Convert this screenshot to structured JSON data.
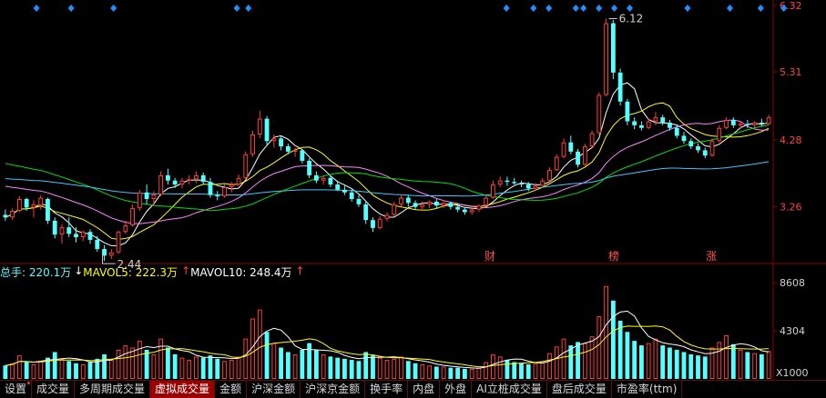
{
  "tabs": [
    {
      "label": "设置",
      "dot": true
    },
    {
      "label": "成交量"
    },
    {
      "label": "多周期成交量"
    },
    {
      "label": "虚拟成交量",
      "active": true
    },
    {
      "label": "金额"
    },
    {
      "label": "沪深金额"
    },
    {
      "label": "沪深京金额"
    },
    {
      "label": "换手率"
    },
    {
      "label": "内盘"
    },
    {
      "label": "外盘"
    },
    {
      "label": "AI立桩成交量"
    },
    {
      "label": "盘后成交量"
    },
    {
      "label": "市盈率(ttm)"
    }
  ],
  "volume_legend": {
    "total_label": "总手: 220.1万",
    "mavol5_arrow": "↓",
    "mavol5_label": "MAVOL5: 222.3万",
    "mavol10_arrow": "↑",
    "mavol10_label": "MAVOL10: 248.4万",
    "mavol10_tail_arrow": "↑"
  },
  "colors": {
    "up": "#ff3c3c",
    "down": "#54ffff",
    "ma5": "#ffffff",
    "ma10": "#ffff00",
    "ma20": "#ff80ff",
    "ma30": "#00e000",
    "ma60": "#3cc8ff",
    "vol_ma5": "#ffffff",
    "vol_ma10": "#ffff00",
    "axis": "#8b0000",
    "axis_label": "#ff4040",
    "diamond": "#1e90ff"
  },
  "chart_data": [
    {
      "type": "candlestick",
      "title": "",
      "y_ticks": [
        "6.32",
        "5.31",
        "4.28",
        "3.26"
      ],
      "ylim": [
        2.4,
        6.32
      ],
      "annotations": {
        "high": {
          "label": "6.12",
          "value": 6.12
        },
        "low": {
          "label": "2.44",
          "value": 2.44
        }
      },
      "event_markers": [
        "财",
        "榜",
        "涨"
      ],
      "ohlc": [
        [
          3.14,
          3.22,
          3.05,
          3.1
        ],
        [
          3.1,
          3.24,
          3.06,
          3.2
        ],
        [
          3.2,
          3.42,
          3.18,
          3.38
        ],
        [
          3.38,
          3.4,
          3.2,
          3.25
        ],
        [
          3.25,
          3.36,
          3.1,
          3.3
        ],
        [
          3.28,
          3.44,
          3.22,
          3.4
        ],
        [
          3.38,
          3.4,
          3.0,
          3.05
        ],
        [
          3.05,
          3.1,
          2.78,
          2.84
        ],
        [
          2.84,
          3.0,
          2.7,
          2.95
        ],
        [
          2.95,
          3.1,
          2.8,
          2.85
        ],
        [
          2.85,
          2.95,
          2.72,
          2.8
        ],
        [
          2.8,
          2.9,
          2.74,
          2.88
        ],
        [
          2.88,
          2.92,
          2.7,
          2.76
        ],
        [
          2.76,
          2.82,
          2.58,
          2.62
        ],
        [
          2.62,
          2.68,
          2.44,
          2.52
        ],
        [
          2.52,
          2.62,
          2.47,
          2.57
        ],
        [
          2.57,
          2.9,
          2.55,
          2.88
        ],
        [
          2.88,
          3.05,
          2.85,
          2.98
        ],
        [
          2.98,
          3.3,
          2.96,
          3.24
        ],
        [
          3.24,
          3.52,
          3.2,
          3.48
        ],
        [
          3.48,
          3.6,
          3.3,
          3.38
        ],
        [
          3.38,
          3.5,
          3.28,
          3.45
        ],
        [
          3.45,
          3.8,
          3.42,
          3.74
        ],
        [
          3.74,
          3.84,
          3.6,
          3.66
        ],
        [
          3.66,
          3.7,
          3.55,
          3.6
        ],
        [
          3.6,
          3.7,
          3.54,
          3.66
        ],
        [
          3.66,
          3.74,
          3.6,
          3.68
        ],
        [
          3.68,
          3.8,
          3.62,
          3.74
        ],
        [
          3.74,
          3.78,
          3.6,
          3.64
        ],
        [
          3.64,
          3.7,
          3.4,
          3.44
        ],
        [
          3.44,
          3.5,
          3.36,
          3.42
        ],
        [
          3.42,
          3.6,
          3.4,
          3.56
        ],
        [
          3.56,
          3.64,
          3.48,
          3.6
        ],
        [
          3.6,
          3.75,
          3.58,
          3.7
        ],
        [
          3.7,
          4.1,
          3.68,
          4.06
        ],
        [
          4.06,
          4.42,
          4.02,
          4.36
        ],
        [
          4.36,
          4.72,
          4.3,
          4.6
        ],
        [
          4.6,
          4.64,
          4.2,
          4.26
        ],
        [
          4.26,
          4.36,
          4.16,
          4.3
        ],
        [
          4.3,
          4.34,
          4.12,
          4.18
        ],
        [
          4.18,
          4.22,
          4.06,
          4.1
        ],
        [
          4.1,
          4.16,
          4.02,
          4.12
        ],
        [
          4.12,
          4.14,
          3.92,
          3.96
        ],
        [
          3.96,
          4.0,
          3.7,
          3.74
        ],
        [
          3.74,
          3.8,
          3.62,
          3.66
        ],
        [
          3.66,
          3.74,
          3.6,
          3.7
        ],
        [
          3.7,
          3.74,
          3.56,
          3.6
        ],
        [
          3.6,
          3.66,
          3.5,
          3.52
        ],
        [
          3.52,
          3.58,
          3.44,
          3.48
        ],
        [
          3.48,
          3.52,
          3.34,
          3.38
        ],
        [
          3.38,
          3.44,
          3.26,
          3.3
        ],
        [
          3.3,
          3.34,
          3.0,
          3.06
        ],
        [
          3.06,
          3.1,
          2.88,
          2.94
        ],
        [
          2.94,
          3.12,
          2.92,
          3.08
        ],
        [
          3.08,
          3.18,
          3.04,
          3.14
        ],
        [
          3.14,
          3.34,
          3.12,
          3.3
        ],
        [
          3.3,
          3.44,
          3.26,
          3.4
        ],
        [
          3.4,
          3.44,
          3.26,
          3.32
        ],
        [
          3.32,
          3.36,
          3.22,
          3.26
        ],
        [
          3.26,
          3.34,
          3.2,
          3.3
        ],
        [
          3.3,
          3.36,
          3.24,
          3.34
        ],
        [
          3.34,
          3.38,
          3.24,
          3.28
        ],
        [
          3.28,
          3.36,
          3.24,
          3.32
        ],
        [
          3.32,
          3.34,
          3.22,
          3.26
        ],
        [
          3.26,
          3.3,
          3.18,
          3.22
        ],
        [
          3.22,
          3.26,
          3.14,
          3.18
        ],
        [
          3.18,
          3.24,
          3.14,
          3.22
        ],
        [
          3.22,
          3.3,
          3.18,
          3.28
        ],
        [
          3.28,
          3.44,
          3.26,
          3.4
        ],
        [
          3.4,
          3.66,
          3.38,
          3.6
        ],
        [
          3.6,
          3.72,
          3.56,
          3.66
        ],
        [
          3.66,
          3.72,
          3.58,
          3.64
        ],
        [
          3.64,
          3.7,
          3.6,
          3.62
        ],
        [
          3.62,
          3.66,
          3.56,
          3.6
        ],
        [
          3.6,
          3.64,
          3.5,
          3.54
        ],
        [
          3.54,
          3.62,
          3.5,
          3.58
        ],
        [
          3.58,
          3.7,
          3.56,
          3.66
        ],
        [
          3.66,
          3.86,
          3.64,
          3.82
        ],
        [
          3.82,
          4.06,
          3.8,
          4.02
        ],
        [
          4.02,
          4.3,
          4.0,
          4.24
        ],
        [
          4.24,
          4.34,
          4.06,
          4.1
        ],
        [
          4.1,
          4.14,
          3.86,
          3.9
        ],
        [
          3.9,
          4.22,
          3.88,
          4.18
        ],
        [
          4.18,
          4.42,
          4.16,
          4.38
        ],
        [
          4.38,
          5.0,
          4.36,
          4.96
        ],
        [
          4.96,
          6.12,
          4.94,
          6.05
        ],
        [
          6.05,
          6.1,
          5.2,
          5.3
        ],
        [
          5.3,
          5.36,
          4.8,
          4.86
        ],
        [
          4.86,
          4.9,
          4.5,
          4.56
        ],
        [
          4.56,
          4.62,
          4.44,
          4.5
        ],
        [
          4.5,
          4.56,
          4.42,
          4.46
        ],
        [
          4.46,
          4.6,
          4.44,
          4.56
        ],
        [
          4.56,
          4.7,
          4.5,
          4.62
        ],
        [
          4.62,
          4.66,
          4.5,
          4.54
        ],
        [
          4.54,
          4.58,
          4.42,
          4.46
        ],
        [
          4.46,
          4.5,
          4.3,
          4.34
        ],
        [
          4.34,
          4.4,
          4.22,
          4.26
        ],
        [
          4.26,
          4.3,
          4.14,
          4.18
        ],
        [
          4.18,
          4.22,
          4.08,
          4.12
        ],
        [
          4.12,
          4.16,
          4.0,
          4.04
        ],
        [
          4.04,
          4.3,
          4.02,
          4.26
        ],
        [
          4.26,
          4.5,
          4.24,
          4.46
        ],
        [
          4.46,
          4.62,
          4.44,
          4.58
        ],
        [
          4.58,
          4.62,
          4.46,
          4.5
        ],
        [
          4.5,
          4.56,
          4.44,
          4.52
        ],
        [
          4.52,
          4.58,
          4.46,
          4.5
        ],
        [
          4.5,
          4.56,
          4.46,
          4.54
        ],
        [
          4.54,
          4.6,
          4.48,
          4.52
        ],
        [
          4.52,
          4.66,
          4.5,
          4.62
        ]
      ]
    },
    {
      "type": "bar",
      "title": "",
      "y_ticks": [
        "8608",
        "4304"
      ],
      "unit_label": "X1000",
      "ylim": [
        0,
        8608
      ],
      "volume": [
        1200,
        1400,
        2100,
        1500,
        1300,
        1600,
        1900,
        2400,
        1800,
        1600,
        1400,
        1300,
        1500,
        1800,
        2200,
        1700,
        2600,
        3000,
        2800,
        3400,
        2600,
        2200,
        3600,
        2800,
        2200,
        1900,
        1700,
        2000,
        1900,
        2100,
        1800,
        1600,
        1700,
        2000,
        3600,
        5400,
        6200,
        4200,
        3200,
        2800,
        2400,
        2200,
        2600,
        3200,
        2600,
        2200,
        2000,
        1900,
        1800,
        1700,
        1600,
        2400,
        2100,
        1900,
        1700,
        1800,
        2000,
        1600,
        1400,
        1300,
        1200,
        1100,
        1100,
        1000,
        1000,
        900,
        900,
        1000,
        1500,
        2200,
        2000,
        1700,
        1500,
        1400,
        1300,
        1400,
        1500,
        2300,
        2900,
        3600,
        3000,
        3300,
        3200,
        3800,
        5600,
        8300,
        7000,
        5200,
        4200,
        3400,
        3000,
        3200,
        3600,
        3000,
        2800,
        2600,
        2400,
        2200,
        2100,
        2000,
        2800,
        3300,
        3900,
        3100,
        2600,
        2400,
        2300,
        2200,
        2500
      ]
    }
  ]
}
